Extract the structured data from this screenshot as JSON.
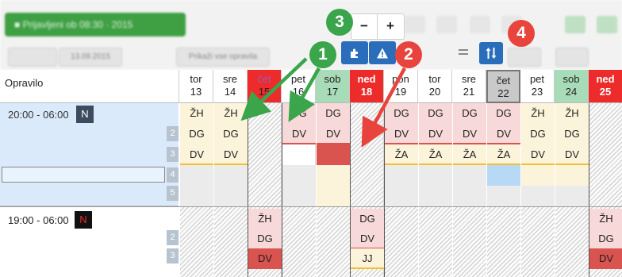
{
  "toolbar": {
    "green_button_label": "■ Prijavljeni ob 08:30 · 2015",
    "zoom_minus": "−",
    "zoom_plus": "+",
    "faded_date": "13.09.2015",
    "faded_filter": "Prikaži vse opravila",
    "puzzle_button_icon": "puzzle-icon",
    "warning_button_icon": "warning-icon",
    "sort_button_icon": "sort-arrows-icon",
    "equals_icon": "equals-icon"
  },
  "header": {
    "corner_label": "Opravilo",
    "days": [
      {
        "day": "tor",
        "date": "13",
        "style": "plain"
      },
      {
        "day": "sre",
        "date": "14",
        "style": "plain"
      },
      {
        "day": "čet",
        "date": "15",
        "style": "holiday"
      },
      {
        "day": "pet",
        "date": "16",
        "style": "plain"
      },
      {
        "day": "sob",
        "date": "17",
        "style": "weekend"
      },
      {
        "day": "ned",
        "date": "18",
        "style": "sunday"
      },
      {
        "day": "pon",
        "date": "19",
        "style": "plain"
      },
      {
        "day": "tor",
        "date": "20",
        "style": "plain"
      },
      {
        "day": "sre",
        "date": "21",
        "style": "plain"
      },
      {
        "day": "čet",
        "date": "22",
        "style": "today"
      },
      {
        "day": "pet",
        "date": "23",
        "style": "plain"
      },
      {
        "day": "sob",
        "date": "24",
        "style": "weekend"
      },
      {
        "day": "ned",
        "date": "25",
        "style": "sunday"
      }
    ]
  },
  "shifts": [
    {
      "time": "20:00 - 06:00",
      "badge": "N",
      "slots": [
        "2",
        "3",
        "4",
        "5"
      ]
    },
    {
      "time": "19:00 - 06:00",
      "badge": "N",
      "slots": [
        "2",
        "3"
      ]
    }
  ],
  "cells": {
    "s1_r1": [
      "ŽH",
      "ŽH",
      "",
      "DG",
      "DG",
      "",
      "DG",
      "DG",
      "DG",
      "DG",
      "ŽH",
      "ŽH",
      ""
    ],
    "s1_r2": [
      "DG",
      "DG",
      "",
      "DV",
      "DV",
      "",
      "DV",
      "DV",
      "DV",
      "DV",
      "DG",
      "DG",
      ""
    ],
    "s1_r3": [
      "DV",
      "DV",
      "",
      "",
      "",
      "",
      "ŽA",
      "ŽA",
      "ŽA",
      "ŽA",
      "DV",
      "DV",
      ""
    ],
    "s2_r1": [
      "",
      "",
      "ŽH",
      "",
      "",
      "DG",
      "",
      "",
      "",
      "",
      "",
      "",
      "ŽH"
    ],
    "s2_r2": [
      "",
      "",
      "DG",
      "",
      "",
      "DV",
      "",
      "",
      "",
      "",
      "",
      "",
      "DG"
    ],
    "s2_r3": [
      "",
      "",
      "DV",
      "",
      "",
      "JJ",
      "",
      "",
      "",
      "",
      "",
      "",
      "DV"
    ]
  },
  "annotations": [
    "1",
    "2",
    "3",
    "4"
  ],
  "colors": {
    "annotation_green": "#3aa54a",
    "annotation_red": "#e8433c",
    "holiday_red": "#ee2b2b",
    "weekend_green": "#a8dcb8",
    "today_grey": "#c9c9c9",
    "toolbar_blue": "#2a6ebb"
  }
}
